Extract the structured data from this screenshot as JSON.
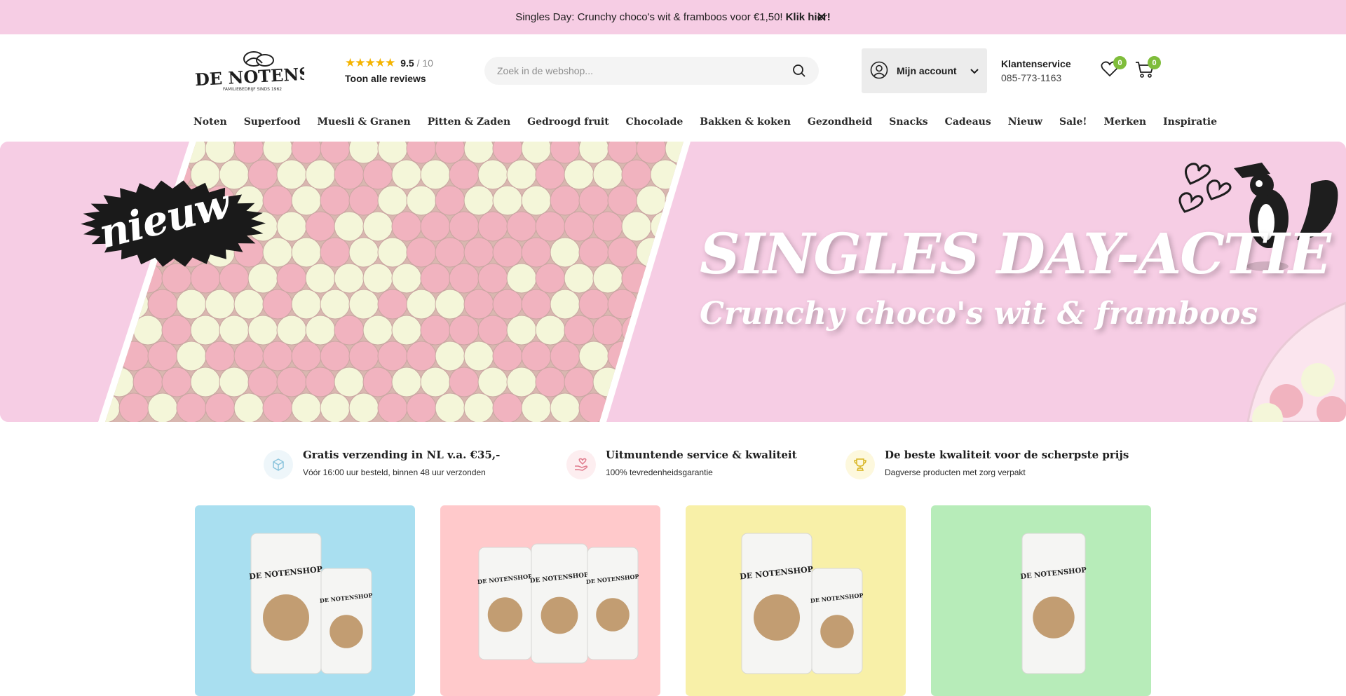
{
  "announcement": {
    "text": "Singles Day: Crunchy choco's wit & framboos voor €1,50!",
    "link": "Klik hier!",
    "close_icon": "close-icon"
  },
  "header": {
    "logo_text": "DE NOTENSHOP",
    "logo_tagline": "FAMILIEBEDRIJF SINDS 1962",
    "rating": {
      "stars": 5,
      "score": "9.5",
      "scale": "/ 10",
      "reviews_link": "Toon alle reviews"
    },
    "search": {
      "placeholder": "Zoek in de webshop...",
      "icon": "search-icon"
    },
    "account": {
      "label": "Mijn account",
      "icon": "user-icon",
      "chevron": "chevron-down-icon"
    },
    "service": {
      "title": "Klantenservice",
      "phone": "085-773-1163"
    },
    "wishlist": {
      "icon": "heart-icon",
      "count": "0"
    },
    "cart": {
      "icon": "cart-icon",
      "count": "0"
    }
  },
  "nav": {
    "items": [
      "Noten",
      "Superfood",
      "Muesli & Granen",
      "Pitten & Zaden",
      "Gedroogd fruit",
      "Chocolade",
      "Bakken & koken",
      "Gezondheid",
      "Snacks",
      "Cadeaus",
      "Nieuw",
      "Sale!",
      "Merken",
      "Inspiratie"
    ]
  },
  "hero": {
    "badge": "nieuw",
    "title": "SINGLES DAY-ACTIE",
    "subtitle": "Crunchy choco's wit & framboos",
    "colors": {
      "background": "#f6cde4",
      "ball_pink": "#f1b3bf",
      "ball_white": "#f4f6d9"
    }
  },
  "usps": [
    {
      "icon": "box-icon",
      "title": "Gratis verzending in NL v.a. €35,-",
      "subtitle": "Vóór 16:00 uur besteld, binnen 48 uur verzonden"
    },
    {
      "icon": "heart-hand-icon",
      "title": "Uitmuntende service & kwaliteit",
      "subtitle": "100% tevredenheidsgarantie"
    },
    {
      "icon": "trophy-icon",
      "title": "De beste kwaliteit voor de scherpste prijs",
      "subtitle": "Dagverse producten met zorg verpakt"
    }
  ],
  "cards": [
    {
      "color": "#a9dff0",
      "bag_text": "DE NOTENSHOP"
    },
    {
      "color": "#ffc9cb",
      "bag_text": "DE NOTENSHOP"
    },
    {
      "color": "#f8f0a8",
      "bag_text": "DE NOTENSHOP"
    },
    {
      "color": "#b7ecb9",
      "bag_text": "DE NOTENSHOP"
    }
  ]
}
